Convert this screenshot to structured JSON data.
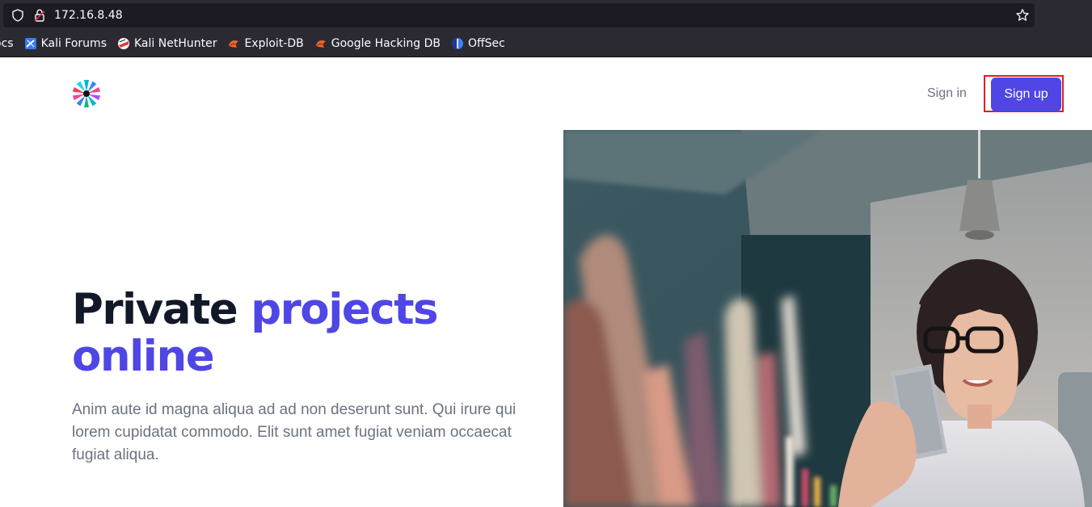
{
  "browser": {
    "url": "172.16.8.48",
    "bookmarks": [
      {
        "label": "ocs",
        "icon": "docs-icon"
      },
      {
        "label": "Kali Forums",
        "icon": "kali-forums-icon"
      },
      {
        "label": "Kali NetHunter",
        "icon": "kali-nethunter-icon"
      },
      {
        "label": "Exploit-DB",
        "icon": "exploit-db-icon"
      },
      {
        "label": "Google Hacking DB",
        "icon": "ghdb-icon"
      },
      {
        "label": "OffSec",
        "icon": "offsec-icon"
      }
    ]
  },
  "nav": {
    "signin_label": "Sign in",
    "signup_label": "Sign up"
  },
  "hero": {
    "title_part1": "Private",
    "title_part2": "projects online",
    "description": "Anim aute id magna aliqua ad ad non deserunt sunt. Qui irure qui lorem cupidatat commodo. Elit sunt amet fugiat veniam occaecat fugiat aliqua."
  },
  "colors": {
    "accent": "#4f46e5",
    "heading": "#111827",
    "muted": "#6b7280",
    "highlight_border": "#e11d24"
  }
}
